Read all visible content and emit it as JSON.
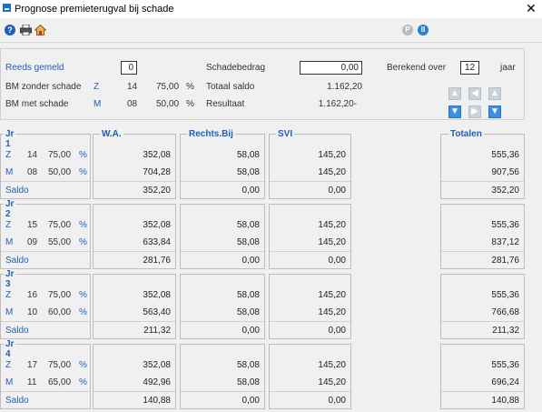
{
  "window": {
    "title": "Prognose premieterugval bij schade",
    "close": "✕"
  },
  "toolbar": {
    "help": "?",
    "right1": "P",
    "right2": "II"
  },
  "form": {
    "reeds_gemeld_label": "Reeds gemeld",
    "reeds_gemeld_value": "0",
    "schadebedrag_label": "Schadebedrag",
    "schadebedrag_value": "0,00",
    "berekend_over_label": "Berekend over",
    "berekend_over_value": "12",
    "jaar_label": "jaar",
    "bm_zonder_label": "BM zonder schade",
    "bm_zonder_code": "Z",
    "bm_zonder_trede": "14",
    "bm_zonder_pct": "75,00",
    "bm_zonder_unit": "%",
    "totaal_saldo_label": "Totaal saldo",
    "totaal_saldo_value": "1.162,20",
    "bm_met_label": "BM met schade",
    "bm_met_code": "M",
    "bm_met_trede": "08",
    "bm_met_pct": "50,00",
    "bm_met_unit": "%",
    "resultaat_label": "Resultaat",
    "resultaat_value": "1.162,20-"
  },
  "columns": {
    "wa": "W.A.",
    "rb": "Rechts.Bij",
    "svi": "SVI",
    "tot": "Totalen"
  },
  "years": [
    {
      "title": "Jr 1",
      "z_code": "Z",
      "z_trede": "14",
      "z_pct": "75,00",
      "m_code": "M",
      "m_trede": "08",
      "m_pct": "50,00",
      "unit": "%",
      "saldo": "Saldo",
      "z_wa": "352,08",
      "m_wa": "704,28",
      "s_wa": "352,20",
      "z_rb": "58,08",
      "m_rb": "58,08",
      "s_rb": "0,00",
      "z_svi": "145,20",
      "m_svi": "145,20",
      "s_svi": "0,00",
      "z_tot": "555,36",
      "m_tot": "907,56",
      "s_tot": "352,20"
    },
    {
      "title": "Jr 2",
      "z_code": "Z",
      "z_trede": "15",
      "z_pct": "75,00",
      "m_code": "M",
      "m_trede": "09",
      "m_pct": "55,00",
      "unit": "%",
      "saldo": "Saldo",
      "z_wa": "352,08",
      "m_wa": "633,84",
      "s_wa": "281,76",
      "z_rb": "58,08",
      "m_rb": "58,08",
      "s_rb": "0,00",
      "z_svi": "145,20",
      "m_svi": "145,20",
      "s_svi": "0,00",
      "z_tot": "555,36",
      "m_tot": "837,12",
      "s_tot": "281,76"
    },
    {
      "title": "Jr 3",
      "z_code": "Z",
      "z_trede": "16",
      "z_pct": "75,00",
      "m_code": "M",
      "m_trede": "10",
      "m_pct": "60,00",
      "unit": "%",
      "saldo": "Saldo",
      "z_wa": "352,08",
      "m_wa": "563,40",
      "s_wa": "211,32",
      "z_rb": "58,08",
      "m_rb": "58,08",
      "s_rb": "0,00",
      "z_svi": "145,20",
      "m_svi": "145,20",
      "s_svi": "0,00",
      "z_tot": "555,36",
      "m_tot": "766,68",
      "s_tot": "211,32"
    },
    {
      "title": "Jr 4",
      "z_code": "Z",
      "z_trede": "17",
      "z_pct": "75,00",
      "m_code": "M",
      "m_trede": "11",
      "m_pct": "65,00",
      "unit": "%",
      "saldo": "Saldo",
      "z_wa": "352,08",
      "m_wa": "492,96",
      "s_wa": "140,88",
      "z_rb": "58,08",
      "m_rb": "58,08",
      "s_rb": "0,00",
      "z_svi": "145,20",
      "m_svi": "145,20",
      "s_svi": "0,00",
      "z_tot": "555,36",
      "m_tot": "696,24",
      "s_tot": "140,88"
    }
  ]
}
